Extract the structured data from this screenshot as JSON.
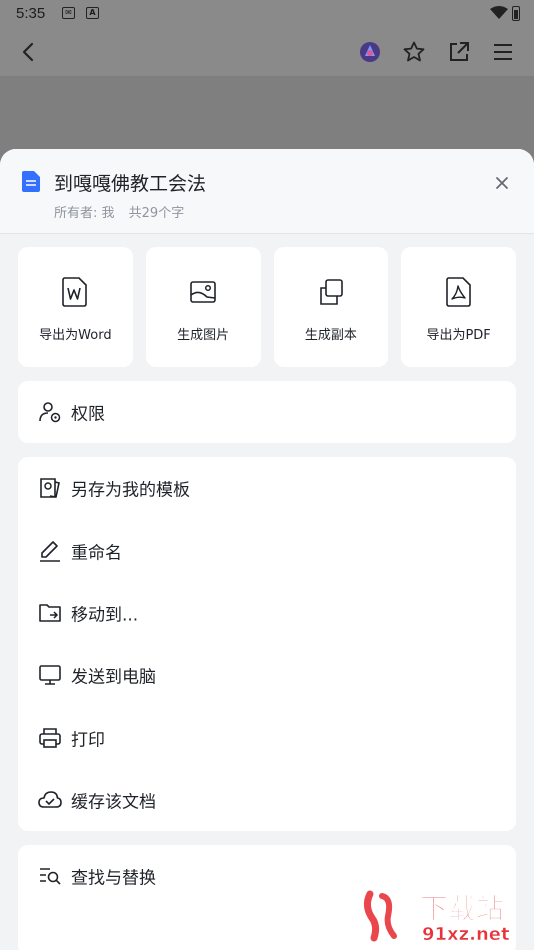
{
  "status_bar": {
    "time": "5:35",
    "note_icon_letter": "A"
  },
  "app_bar": {
    "icons": [
      "back-arrow-icon",
      "ai-assistant-icon",
      "star-icon",
      "share-icon",
      "menu-icon"
    ]
  },
  "sheet": {
    "title": "到嘎嘎佛教工会法",
    "owner": "所有者: 我",
    "word_count": "共29个字",
    "tiles": [
      {
        "label": "导出为Word",
        "icon": "word-icon"
      },
      {
        "label": "生成图片",
        "icon": "image-icon"
      },
      {
        "label": "生成副本",
        "icon": "copy-icon"
      },
      {
        "label": "导出为PDF",
        "icon": "pdf-icon"
      }
    ],
    "permission": {
      "label": "权限",
      "icon": "user-settings-icon"
    },
    "actions": [
      {
        "label": "另存为我的模板",
        "icon": "template-icon"
      },
      {
        "label": "重命名",
        "icon": "pencil-icon"
      },
      {
        "label": "移动到...",
        "icon": "folder-move-icon"
      },
      {
        "label": "发送到电脑",
        "icon": "monitor-icon"
      },
      {
        "label": "打印",
        "icon": "printer-icon"
      },
      {
        "label": "缓存该文档",
        "icon": "cloud-check-icon"
      }
    ],
    "search": {
      "label": "查找与替换",
      "icon": "find-replace-icon"
    }
  },
  "watermark": {
    "brand": "下载站",
    "domain": "91xz.net"
  },
  "colors": {
    "accent": "#3370ff",
    "text": "#1f2329",
    "muted": "#8f959e",
    "watermark": "#e8333a"
  }
}
